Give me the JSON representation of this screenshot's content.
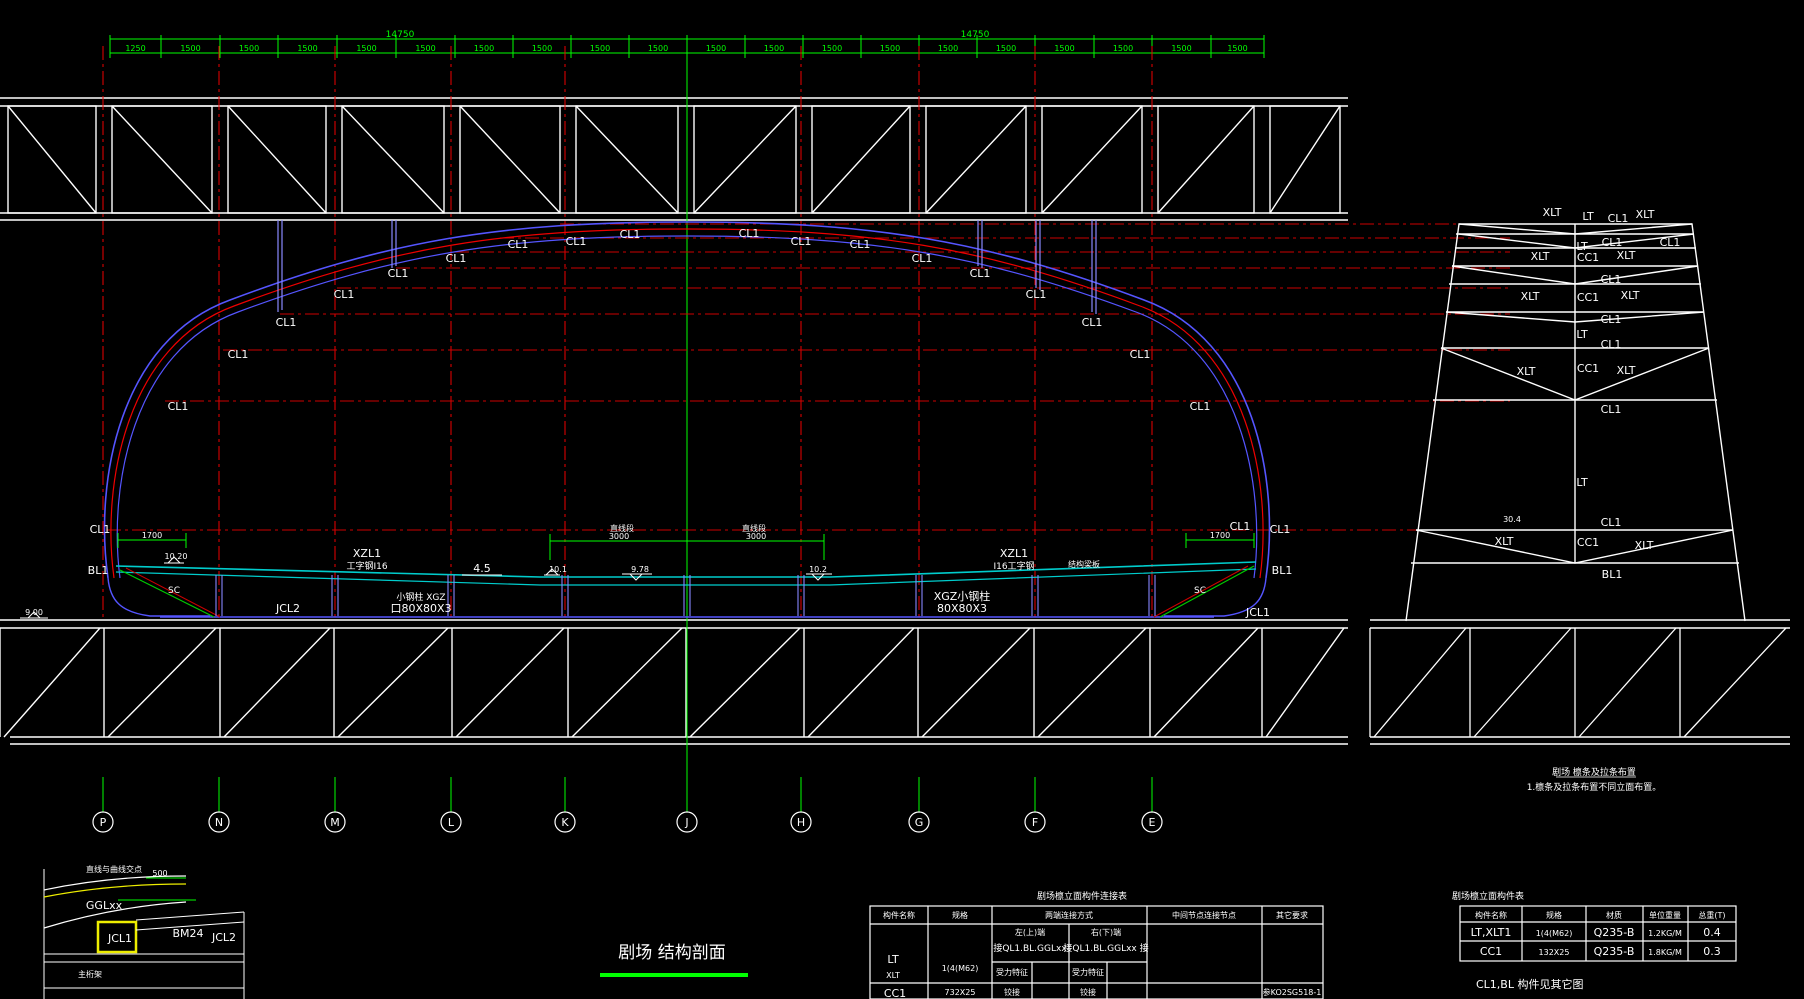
{
  "dims": {
    "top_total_left": "14750",
    "top_total_right": "14750",
    "top_segments": [
      "1250",
      "1500",
      "1500",
      "1500",
      "1500",
      "1500",
      "1500",
      "1500",
      "1500",
      "1500",
      "1500",
      "1500",
      "1500",
      "1500",
      "1500",
      "1500",
      "1500",
      "1500",
      "1500",
      "1500",
      "1250"
    ],
    "left_offset": "1700",
    "right_offset": "1700",
    "center_left": "3000",
    "center_right": "3000",
    "mini_offset": "500"
  },
  "labels": {
    "cl1": "CL1",
    "bl1": "BL1",
    "xzl1": "XZL1",
    "i16_left": "工字钢I16",
    "i16_right": "I16工字钢",
    "slope": "4.5",
    "xgz_left": "小钢柱 XGZ",
    "xgz_left_size": "口80X80X3",
    "xgz_right": "XGZ小钢柱",
    "xgz_right_size": "80X80X3",
    "jcl2": "JCL2",
    "jcl1": "JCL1",
    "sc": "SC",
    "zhixian": "直线段",
    "level_left": "9.00",
    "level_a": "10.20",
    "level_b": "10.1",
    "level_c": "9.78",
    "level_d": "10.2",
    "struct_label": "结构梁板",
    "ggl": "GGLxx",
    "bm24": "BM24",
    "main_truss": "主桁架",
    "mini_title": "直线与曲线交点"
  },
  "axes": [
    "P",
    "N",
    "M",
    "L",
    "K",
    "J",
    "H",
    "G",
    "F",
    "E"
  ],
  "side_elevation": {
    "xlt": "XLT",
    "lt": "LT",
    "cl1": "CL1",
    "cc1": "CC1",
    "bl1": "BL1",
    "note_title": "剧场 檩条及拉条布置",
    "note_line": "1.檩条及拉条布置不同立面布置。",
    "dim": "30.4"
  },
  "title": "剧场 结构剖面",
  "conn_table": {
    "caption": "剧场檩立面构件连接表",
    "headers": [
      "构件名称",
      "规格",
      "两端连接方式",
      "中间节点连接节点",
      "其它要求"
    ],
    "sub_left": "左(上)端",
    "sub_right": "右(下)端",
    "sub_left_val": "接QL1.BL.GGLxx",
    "sub_right_val": "接QL1.BL.GGLxx 接",
    "force": "受力特征",
    "rows": [
      {
        "name": "LT",
        "name2": "XLT",
        "spec": "1(4(M62)"
      },
      {
        "name": "CC1",
        "spec": "732X25",
        "left": "铰接",
        "right": "铰接",
        "note": "参KO2SG518-1"
      }
    ]
  },
  "mat_table": {
    "caption": "剧场檩立面构件表",
    "headers": [
      "构件名称",
      "规格",
      "材质",
      "单位重量",
      "总重(T)"
    ],
    "rows": [
      {
        "name": "LT,XLT1",
        "spec": "1(4(M62)",
        "mat": "Q235-B",
        "unit": "1.2KG/M",
        "total": "0.4"
      },
      {
        "name": "CC1",
        "spec": "132X25",
        "mat": "Q235-B",
        "unit": "1.8KG/M",
        "total": "0.3"
      }
    ],
    "footnote": "CL1,BL 构件见其它图"
  }
}
